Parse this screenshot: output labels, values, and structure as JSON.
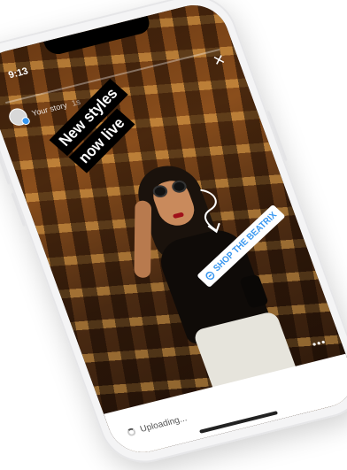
{
  "status_bar": {
    "time": "9:13"
  },
  "story": {
    "progress_fraction": 0.0,
    "owner_label": "Your story",
    "ago": "1s",
    "headline_line1": "New styles",
    "headline_line2": "now live",
    "sticker_label": "SHOP THE BEATRIX",
    "sticker_icon": "link-icon",
    "close_icon": "close-icon",
    "more_icon": "more-icon"
  },
  "footer": {
    "upload_status": "Uploading..."
  },
  "colors": {
    "sticker_text": "#3897f0",
    "headline_bg": "#000000",
    "headline_text": "#ffffff",
    "footer_bg": "#ffffff"
  }
}
